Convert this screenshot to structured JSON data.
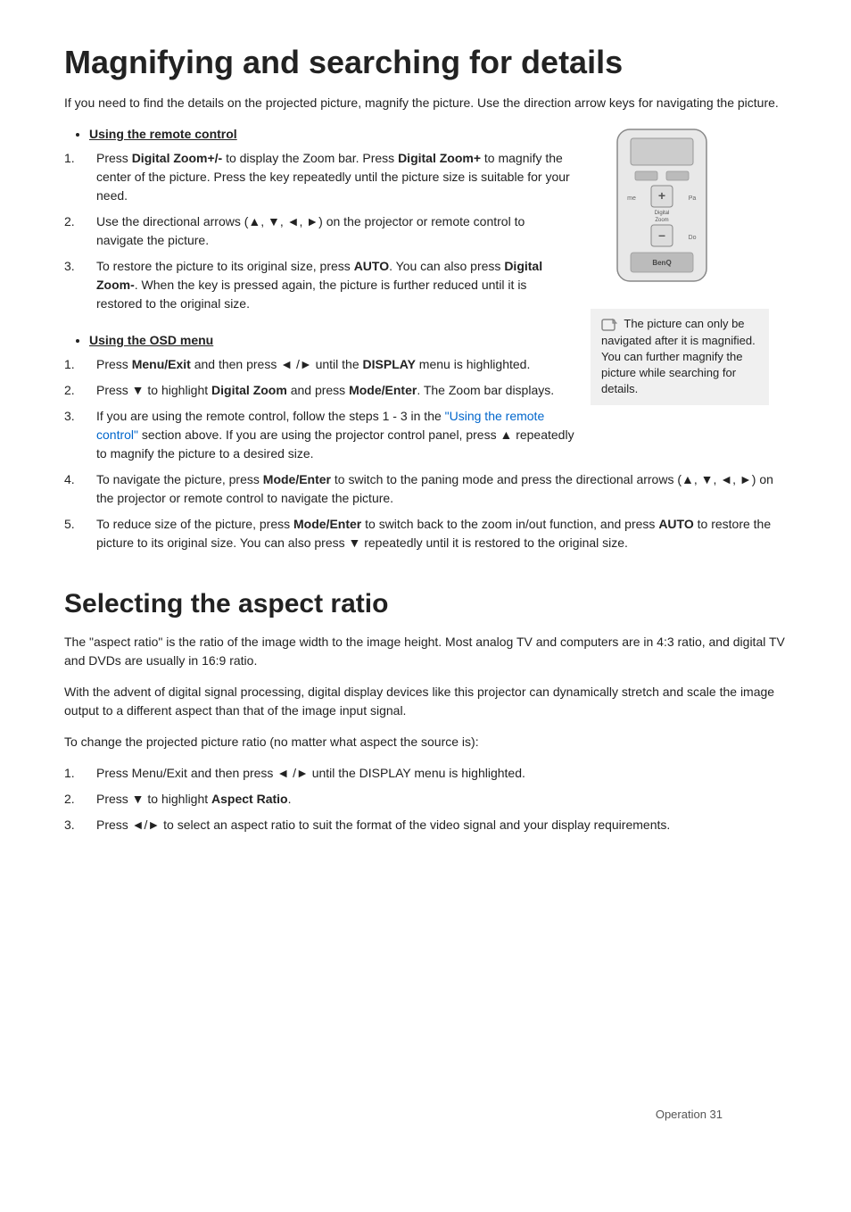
{
  "page": {
    "title": "Magnifying and searching for details",
    "title2": "Selecting the aspect ratio",
    "intro": "If you need to find the details on the projected picture, magnify the picture. Use the direction arrow keys for navigating the picture.",
    "section1_bullet": "Using the remote control",
    "section1_items": [
      {
        "num": "1.",
        "text_parts": [
          {
            "text": "Press ",
            "style": "normal"
          },
          {
            "text": "Digital Zoom+/-",
            "style": "bold"
          },
          {
            "text": " to display the Zoom bar. Press ",
            "style": "normal"
          },
          {
            "text": "Digital Zoom+",
            "style": "bold"
          },
          {
            "text": " to magnify the center of the picture. Press the key repeatedly until the picture size is suitable for your need.",
            "style": "normal"
          }
        ]
      },
      {
        "num": "2.",
        "text_parts": [
          {
            "text": "Use the directional arrows (▲, ▼, ◄, ►) on the projector or remote control to navigate the picture.",
            "style": "normal"
          }
        ]
      },
      {
        "num": "3.",
        "text_parts": [
          {
            "text": "To restore the picture to its original size, press ",
            "style": "normal"
          },
          {
            "text": "AUTO",
            "style": "bold"
          },
          {
            "text": ". You can also press ",
            "style": "normal"
          },
          {
            "text": "Digital Zoom-",
            "style": "bold"
          },
          {
            "text": ". When the key is pressed again, the picture is further reduced until it is restored to the original size.",
            "style": "normal"
          }
        ]
      }
    ],
    "note_text": "The picture can only be navigated after it is magnified. You can further magnify the picture while searching for details.",
    "section2_bullet": "Using the OSD menu",
    "section2_items": [
      {
        "num": "1.",
        "text_parts": [
          {
            "text": "Press ",
            "style": "normal"
          },
          {
            "text": "Menu/Exit",
            "style": "bold"
          },
          {
            "text": " and then press ◄ /► until the ",
            "style": "normal"
          },
          {
            "text": "DISPLAY",
            "style": "bold"
          },
          {
            "text": " menu is highlighted.",
            "style": "normal"
          }
        ]
      },
      {
        "num": "2.",
        "text_parts": [
          {
            "text": "Press ▼ to highlight ",
            "style": "normal"
          },
          {
            "text": "Digital Zoom",
            "style": "bold"
          },
          {
            "text": " and press ",
            "style": "normal"
          },
          {
            "text": "Mode/Enter",
            "style": "bold"
          },
          {
            "text": ". The Zoom bar displays.",
            "style": "normal"
          }
        ]
      },
      {
        "num": "3.",
        "text_parts": [
          {
            "text": "If you are using the remote control, follow the steps 1 - 3 in the ",
            "style": "normal"
          },
          {
            "text": "\"Using the remote control\"",
            "style": "link"
          },
          {
            "text": " section above. If you are using the projector control panel, press ▲ repeatedly to magnify the picture to a desired size.",
            "style": "normal"
          }
        ]
      },
      {
        "num": "4.",
        "text_parts": [
          {
            "text": "To navigate the picture, press ",
            "style": "normal"
          },
          {
            "text": "Mode/Enter",
            "style": "bold"
          },
          {
            "text": " to switch to the paning mode and press the directional arrows (▲, ▼, ◄, ►) on the projector or remote control to navigate the picture.",
            "style": "normal"
          }
        ]
      },
      {
        "num": "5.",
        "text_parts": [
          {
            "text": "To reduce size of the picture, press ",
            "style": "normal"
          },
          {
            "text": "Mode/Enter",
            "style": "bold"
          },
          {
            "text": " to switch back to the zoom in/out function, and press ",
            "style": "normal"
          },
          {
            "text": "AUTO",
            "style": "bold"
          },
          {
            "text": " to restore the picture to its original size. You can also press ▼ repeatedly until it is restored to the original size.",
            "style": "normal"
          }
        ]
      }
    ],
    "section3_intro1": "The \"aspect ratio\" is the ratio of the image width to the image height. Most analog TV and computers are in 4:3 ratio, and digital TV and DVDs are usually in 16:9 ratio.",
    "section3_intro2": "With the advent of digital signal processing, digital display devices like this projector can dynamically stretch and scale the image output to a different aspect than that of the image input signal.",
    "section3_intro3": "To change the projected picture ratio (no matter what aspect the source is):",
    "section3_items": [
      {
        "num": "1.",
        "text_parts": [
          {
            "text": "Press Menu/Exit and then press ◄ /► until the DISPLAY menu is highlighted.",
            "style": "normal"
          }
        ]
      },
      {
        "num": "2.",
        "text_parts": [
          {
            "text": "Press ▼ to highlight ",
            "style": "normal"
          },
          {
            "text": "Aspect Ratio",
            "style": "bold"
          },
          {
            "text": ".",
            "style": "normal"
          }
        ]
      },
      {
        "num": "3.",
        "text_parts": [
          {
            "text": "Press ◄/► to select an aspect ratio to suit the format of the video signal and your display requirements.",
            "style": "normal"
          }
        ]
      }
    ],
    "footer": "Operation    31"
  }
}
